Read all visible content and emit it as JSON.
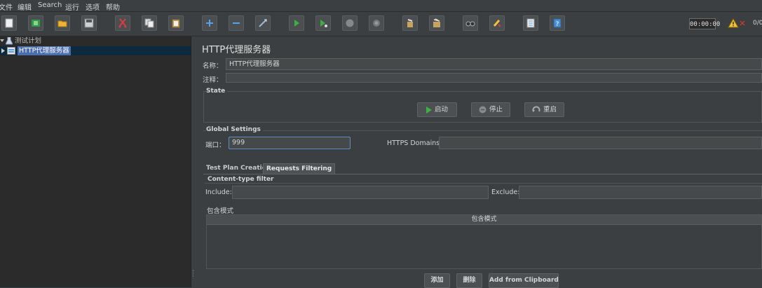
{
  "menu": {
    "file": "文件",
    "edit": "编辑",
    "search": "Search",
    "run": "运行",
    "options": "选项",
    "help": "帮助"
  },
  "toolbar": {
    "timer": "00:00:00",
    "error_count": "0/0"
  },
  "tree": {
    "root_label": "测试计划",
    "child_label": "HTTP代理服务器"
  },
  "panel": {
    "title": "HTTP代理服务器",
    "name_label": "名称：",
    "name_value": "HTTP代理服务器",
    "comment_label": "注释：",
    "comment_value": ""
  },
  "state": {
    "title": "State",
    "start_label": "启动",
    "stop_label": "停止",
    "restart_label": "重启"
  },
  "global": {
    "title": "Global Settings",
    "port_label": "端口：",
    "port_value": "999",
    "https_label": "HTTPS Domains:",
    "https_value": ""
  },
  "tabs": [
    {
      "label": "Test Plan Creation",
      "active": false
    },
    {
      "label": "Requests Filtering",
      "active": true
    }
  ],
  "content_filter": {
    "title": "Content-type filter",
    "include_label": "Include:",
    "include_value": "",
    "exclude_label": "Exclude:",
    "exclude_value": ""
  },
  "include_patterns": {
    "title": "包含模式",
    "column_header": "包含模式"
  },
  "actions": {
    "add_label": "添加",
    "delete_label": "删除",
    "clipboard_label": "Add from Clipboard"
  },
  "colors": {
    "selection": "#0d293e",
    "focus_border": "#5d8dc7",
    "start_green": "#3cb043"
  }
}
